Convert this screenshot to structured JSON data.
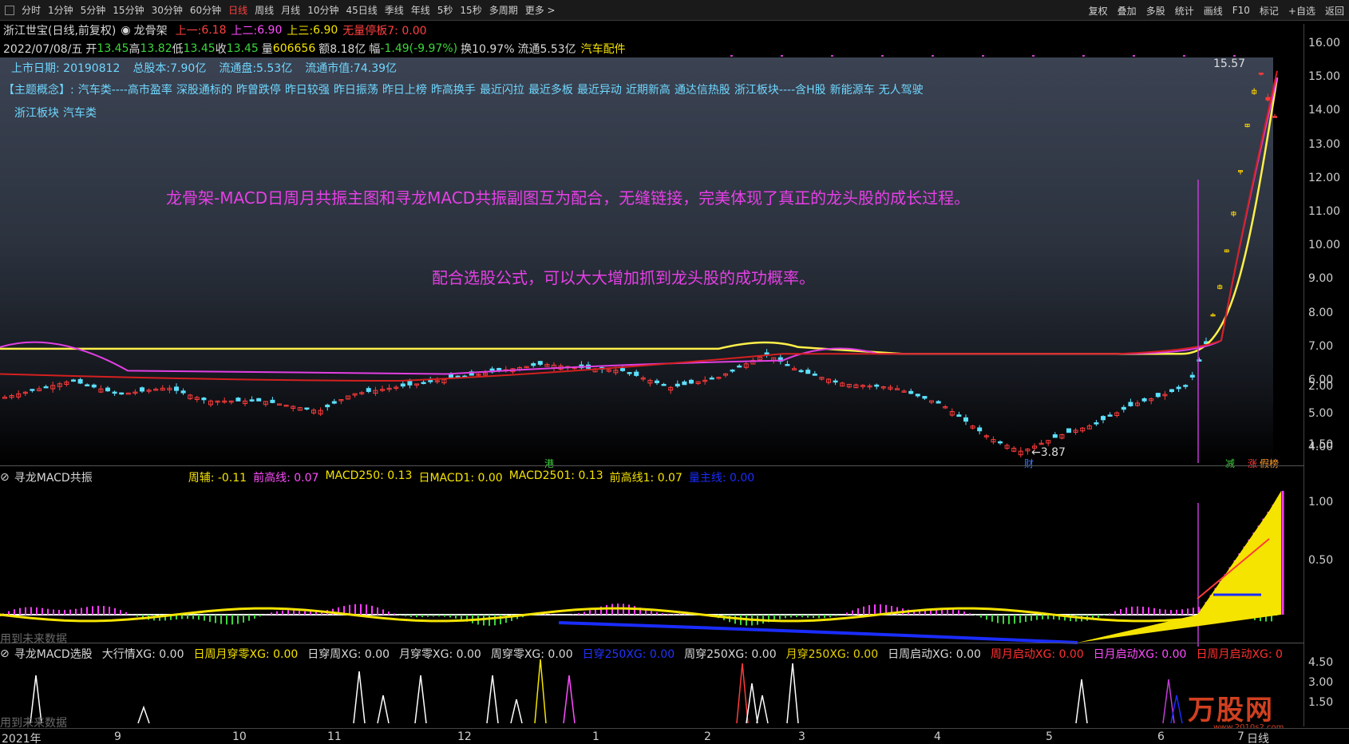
{
  "toolbar": {
    "periods": [
      "分时",
      "1分钟",
      "5分钟",
      "15分钟",
      "30分钟",
      "60分钟",
      "日线",
      "周线",
      "月线",
      "10分钟",
      "45日线",
      "季线",
      "年线",
      "5秒",
      "15秒",
      "多周期",
      "更多 >"
    ],
    "active": "日线",
    "right": [
      "复权",
      "叠加",
      "多股",
      "统计",
      "画线",
      "F10",
      "标记",
      "+自选",
      "返回"
    ]
  },
  "title": {
    "stock": "浙江世宝(日线,前复权)",
    "indicator_icon": "circle-icon",
    "indicator": "龙骨架",
    "s1_label": "上一: ",
    "s1_val": "6.18",
    "s2_label": "上二: ",
    "s2_val": "6.90",
    "s3_label": "上三: ",
    "s3_val": "6.90",
    "s4": "无量停板7: 0.00"
  },
  "quote": {
    "date": "2022/07/08/五",
    "open_label": "开",
    "open": "13.45",
    "high_label": "高",
    "high": "13.82",
    "low_label": "低",
    "low": "13.45",
    "close_label": "收",
    "close": "13.45",
    "vol_label": "量",
    "vol": "606656",
    "amt_label": "额",
    "amt": "8.18亿",
    "chg_label": "幅",
    "chg": "-1.49(-9.97%)",
    "turn": "换10.97%",
    "float": "流通5.53亿",
    "industry": "汽车配件"
  },
  "info": {
    "list_date": "上市日期: 20190812",
    "total_cap": "总股本:7.90亿",
    "float_shares": "流通盘:5.53亿",
    "float_value": "流通市值:74.39亿",
    "concept_head": "【主题概念】:",
    "concepts": [
      "汽车类----高市盈率",
      "深股通标的",
      "昨曾跌停",
      "昨日较强",
      "昨日振荡",
      "昨日上榜",
      "昨高换手",
      "最近闪拉",
      "最近多板",
      "最近异动",
      "近期新高",
      "通达信热股",
      "浙江板块----含H股",
      "新能源车",
      "无人驾驶"
    ],
    "concepts2": [
      "浙江板块",
      "汽车类"
    ]
  },
  "notes": {
    "line1": "龙骨架-MACD日周月共振主图和寻龙MACD共振副图互为配合，无缝链接，完美体现了真正的龙头股的成长过程。",
    "line2": "配合选股公式，可以大大增加抓到龙头股的成功概率。"
  },
  "main_chart": {
    "yticks": [
      "16.00",
      "15.00",
      "14.00",
      "13.00",
      "12.00",
      "11.00",
      "10.00",
      "9.00",
      "8.00",
      "7.00",
      "6.00",
      "5.00",
      "4.00"
    ],
    "high_label": "15.57",
    "low_label": "3.87",
    "markers": [
      "港",
      "财",
      "减",
      "涨",
      "假榜"
    ]
  },
  "panel1": {
    "name": "寻龙MACD共振",
    "values": [
      {
        "label": "周辅: -0.11",
        "color": "#f5e300"
      },
      {
        "label": "前高线: 0.07",
        "color": "#ff4cff"
      },
      {
        "label": "MACD250: 0.13",
        "color": "#f5e300"
      },
      {
        "label": "日MACD1: 0.00",
        "color": "#f5e300"
      },
      {
        "label": "MACD2501: 0.13",
        "color": "#f5e300"
      },
      {
        "label": "前高线1: 0.07",
        "color": "#f5e300"
      },
      {
        "label": "量主线: 0.00",
        "color": "#1a2cff"
      }
    ],
    "yticks": [
      "2.00",
      "1.50",
      "1.00",
      "0.50"
    ],
    "footer": "用到未来数据"
  },
  "panel2": {
    "name": "寻龙MACD选股",
    "values": [
      {
        "label": "大行情XG: 0.00",
        "color": "#d8d8d8"
      },
      {
        "label": "日周月穿零XG: 0.00",
        "color": "#f5e300"
      },
      {
        "label": "日穿周XG: 0.00",
        "color": "#d8d8d8"
      },
      {
        "label": "月穿零XG: 0.00",
        "color": "#d8d8d8"
      },
      {
        "label": "周穿零XG: 0.00",
        "color": "#d8d8d8"
      },
      {
        "label": "日穿250XG: 0.00",
        "color": "#2233ff"
      },
      {
        "label": "周穿250XG: 0.00",
        "color": "#d8d8d8"
      },
      {
        "label": "月穿250XG: 0.00",
        "color": "#e8d200"
      },
      {
        "label": "日周启动XG: 0.00",
        "color": "#d8d8d8"
      },
      {
        "label": "周月启动XG: 0.00",
        "color": "#ff3030"
      },
      {
        "label": "日月启动XG: 0.00",
        "color": "#ff4cff"
      },
      {
        "label": "日周月启动XG: 0",
        "color": "#ff3030"
      }
    ],
    "yticks": [
      "4.50",
      "3.00",
      "1.50"
    ],
    "footer": "用到未来数据"
  },
  "xaxis": {
    "labels": [
      "2021年",
      "9",
      "10",
      "11",
      "12",
      "1",
      "2",
      "3",
      "4",
      "5",
      "6",
      "7"
    ],
    "right": "日线"
  },
  "watermark": {
    "text": "万股网",
    "sub": "www.2010s2.com"
  }
}
